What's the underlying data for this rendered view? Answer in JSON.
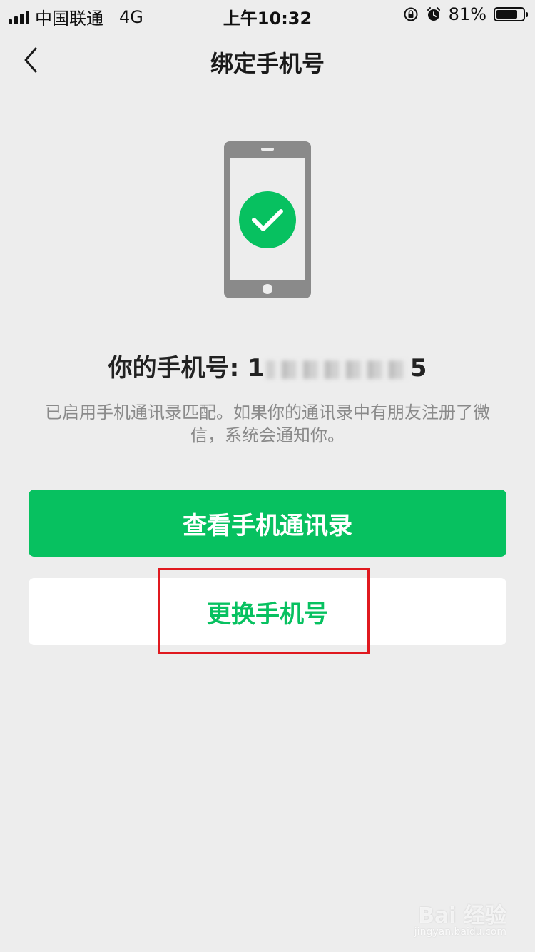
{
  "status_bar": {
    "carrier": "中国联通",
    "network": "4G",
    "time": "上午10:32",
    "battery_percent": "81%",
    "battery_level": 0.81,
    "icons": [
      "signal-icon",
      "rotation-lock-icon",
      "alarm-icon",
      "battery-icon"
    ]
  },
  "nav": {
    "back_icon": "chevron-left-icon",
    "title": "绑定手机号"
  },
  "illustration": {
    "icon": "phone-checkmark-icon",
    "check_color": "#07c160",
    "phone_color": "#8a8a8a"
  },
  "phone": {
    "label": "你的手机号:",
    "number_prefix": "1",
    "number_suffix": "5"
  },
  "description": "已启用手机通讯录匹配。如果你的通讯录中有朋友注册了微信，系统会通知你。",
  "buttons": {
    "view_contacts": "查看手机通讯录",
    "change_number": "更换手机号"
  },
  "colors": {
    "accent": "#07c160",
    "highlight_box": "#e0191f",
    "background": "#ededed"
  },
  "watermark": {
    "brand": "Bai 经验",
    "url": "jingyan.baidu.com"
  }
}
